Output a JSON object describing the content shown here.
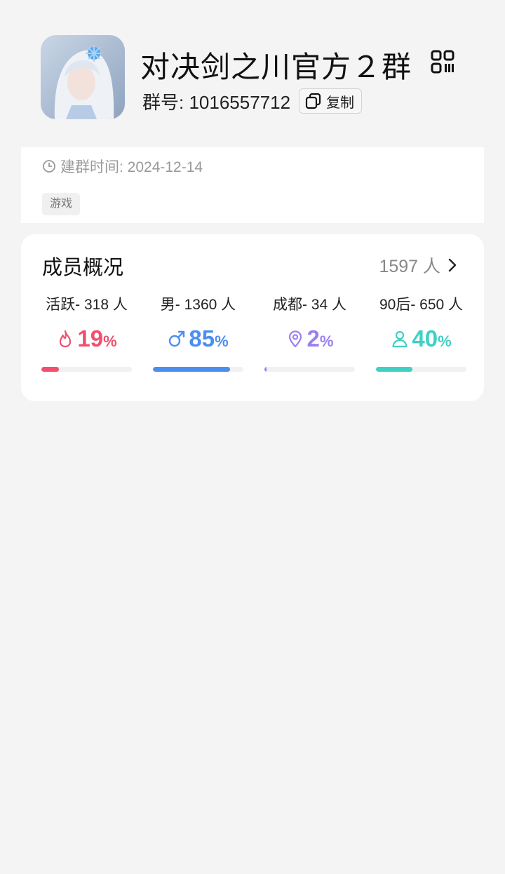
{
  "header": {
    "group_name": "对决剑之川官方２群",
    "group_id_label": "群号: 1016557712",
    "copy_label": "复制"
  },
  "info": {
    "created_label": "建群时间: 2024-12-14",
    "tag": "游戏"
  },
  "members": {
    "title": "成员概况",
    "total": "1597 人",
    "stats": [
      {
        "label": "活跃- 318 人",
        "value": "19",
        "pct": "%",
        "fraction": 0.19,
        "color": "#f0506e",
        "icon": "fire-icon"
      },
      {
        "label": "男- 1360 人",
        "value": "85",
        "pct": "%",
        "fraction": 0.85,
        "color": "#4c8ef0",
        "icon": "male-icon"
      },
      {
        "label": "成都- 34 人",
        "value": "2",
        "pct": "%",
        "fraction": 0.02,
        "color": "#9b7ff0",
        "icon": "location-pin-icon"
      },
      {
        "label": "90后- 650 人",
        "value": "40",
        "pct": "%",
        "fraction": 0.4,
        "color": "#3fd1c4",
        "icon": "person-icon"
      }
    ]
  }
}
